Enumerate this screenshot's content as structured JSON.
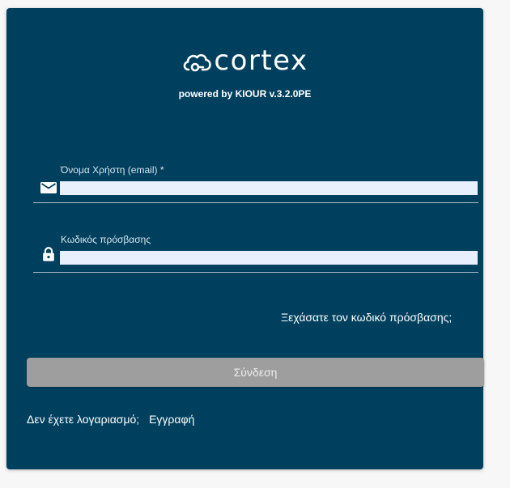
{
  "brand": {
    "name": "cortex",
    "powered_by": "powered by KIOUR v.3.2.0PE"
  },
  "form": {
    "email": {
      "label": "Όνομα Χρήστη (email) *",
      "value": "",
      "icon": "envelope-icon"
    },
    "password": {
      "label": "Κωδικός πρόσβασης",
      "value": "",
      "icon": "lock-icon"
    },
    "forgot_password": "Ξεχάσατε τον κωδικό πρόσβασης;",
    "submit_label": "Σύνδεση",
    "no_account_text": "Δεν έχετε λογαριασμό;",
    "register_label": "Εγγραφή"
  },
  "colors": {
    "panel": "#00405f",
    "input_fill": "#e8f0fe",
    "button": "#9e9e9e",
    "text": "#ffffff"
  }
}
